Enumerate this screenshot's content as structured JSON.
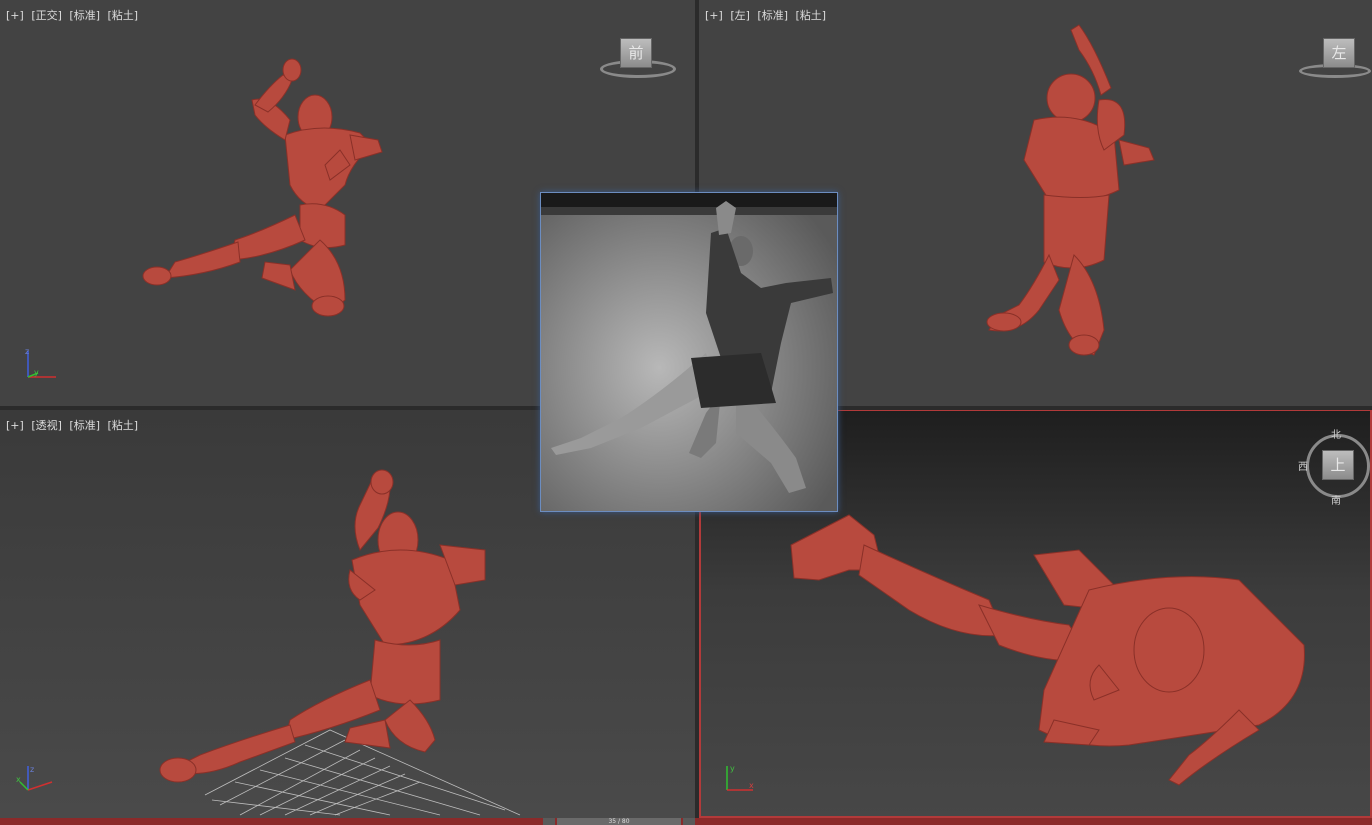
{
  "viewports": {
    "front": {
      "labels": [
        "[+]",
        "[正交]",
        "[标准]",
        "[粘土]"
      ],
      "cube_label": "前"
    },
    "left": {
      "labels": [
        "[+]",
        "[左]",
        "[标准]",
        "[粘土]"
      ],
      "cube_label": "左"
    },
    "persp": {
      "labels": [
        "[+]",
        "[透视]",
        "[标准]",
        "[粘土]"
      ]
    },
    "top": {
      "cube_label": "上",
      "compass": {
        "north": "北",
        "south": "南",
        "west": "西"
      }
    }
  },
  "axes": {
    "x": "x",
    "y": "y",
    "z": "z"
  },
  "timeline": {
    "frame": "35 / 80"
  },
  "colors": {
    "figure": "#b84a3e",
    "active_border": "#b23a3a",
    "axis_x": "#d03030",
    "axis_y": "#30c030",
    "axis_z": "#4060e0"
  }
}
